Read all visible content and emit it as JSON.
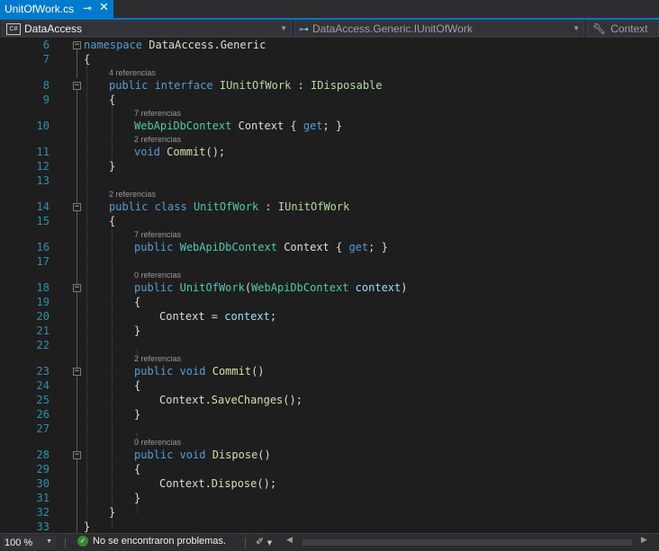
{
  "tab": {
    "title": "UnitOfWork.cs",
    "pin_glyph": "⊸",
    "close_glyph": "✕"
  },
  "nav": {
    "project": "DataAccess",
    "type": "DataAccess.Generic.IUnitOfWork",
    "member": "Context",
    "cs_badge": "C#"
  },
  "colors": {
    "accent": "#007acc",
    "keyword": "#569cd6",
    "type": "#4ec9b0",
    "interface": "#b8d7a3",
    "line_number": "#2b91af",
    "ok": "#388a34"
  },
  "line_numbers": [
    "6",
    "7",
    "8",
    "9",
    "10",
    "11",
    "12",
    "13",
    "14",
    "15",
    "16",
    "17",
    "18",
    "19",
    "20",
    "21",
    "22",
    "23",
    "24",
    "25",
    "26",
    "27",
    "28",
    "29",
    "30",
    "31",
    "32",
    "33"
  ],
  "lens": {
    "l8": "4 referencias",
    "l10": "7 referencias",
    "l11": "2 referencias",
    "l14": "2 referencias",
    "l16": "7 referencias",
    "l18": "0 referencias",
    "l23": "2 referencias",
    "l28": "0 referencias"
  },
  "code": {
    "ns_kw": "namespace",
    "ns_name": " DataAccess.Generic",
    "open_brace": "{",
    "close_brace": "}",
    "public": "public",
    "interface": " interface ",
    "iface_name": "IUnitOfWork",
    "colon": " : ",
    "idisposable": "IDisposable",
    "dbcontext": "WebApiDbContext",
    "context_prop": " Context { ",
    "get": "get",
    "prop_end": "; }",
    "void": "void",
    "commit_name": " Commit",
    "commit_call": "();",
    "class_kw": " class ",
    "class_name": "UnitOfWork",
    "space": " ",
    "ctor_name": "UnitOfWork",
    "ctor_open": "(",
    "ctor_param": " context",
    "ctor_close": ")",
    "assign_lhs": "Context = ",
    "assign_rhs": "context",
    "semicolon": ";",
    "void_commit": " void ",
    "commit": "Commit",
    "parens": "()",
    "ctx_dot": "Context.",
    "savechanges": "SaveChanges",
    "call_end": "();",
    "dispose": "Dispose"
  },
  "status": {
    "zoom": "100 %",
    "message": "No se encontraron problemas.",
    "check_glyph": "✓",
    "brush_glyph": "✐"
  }
}
